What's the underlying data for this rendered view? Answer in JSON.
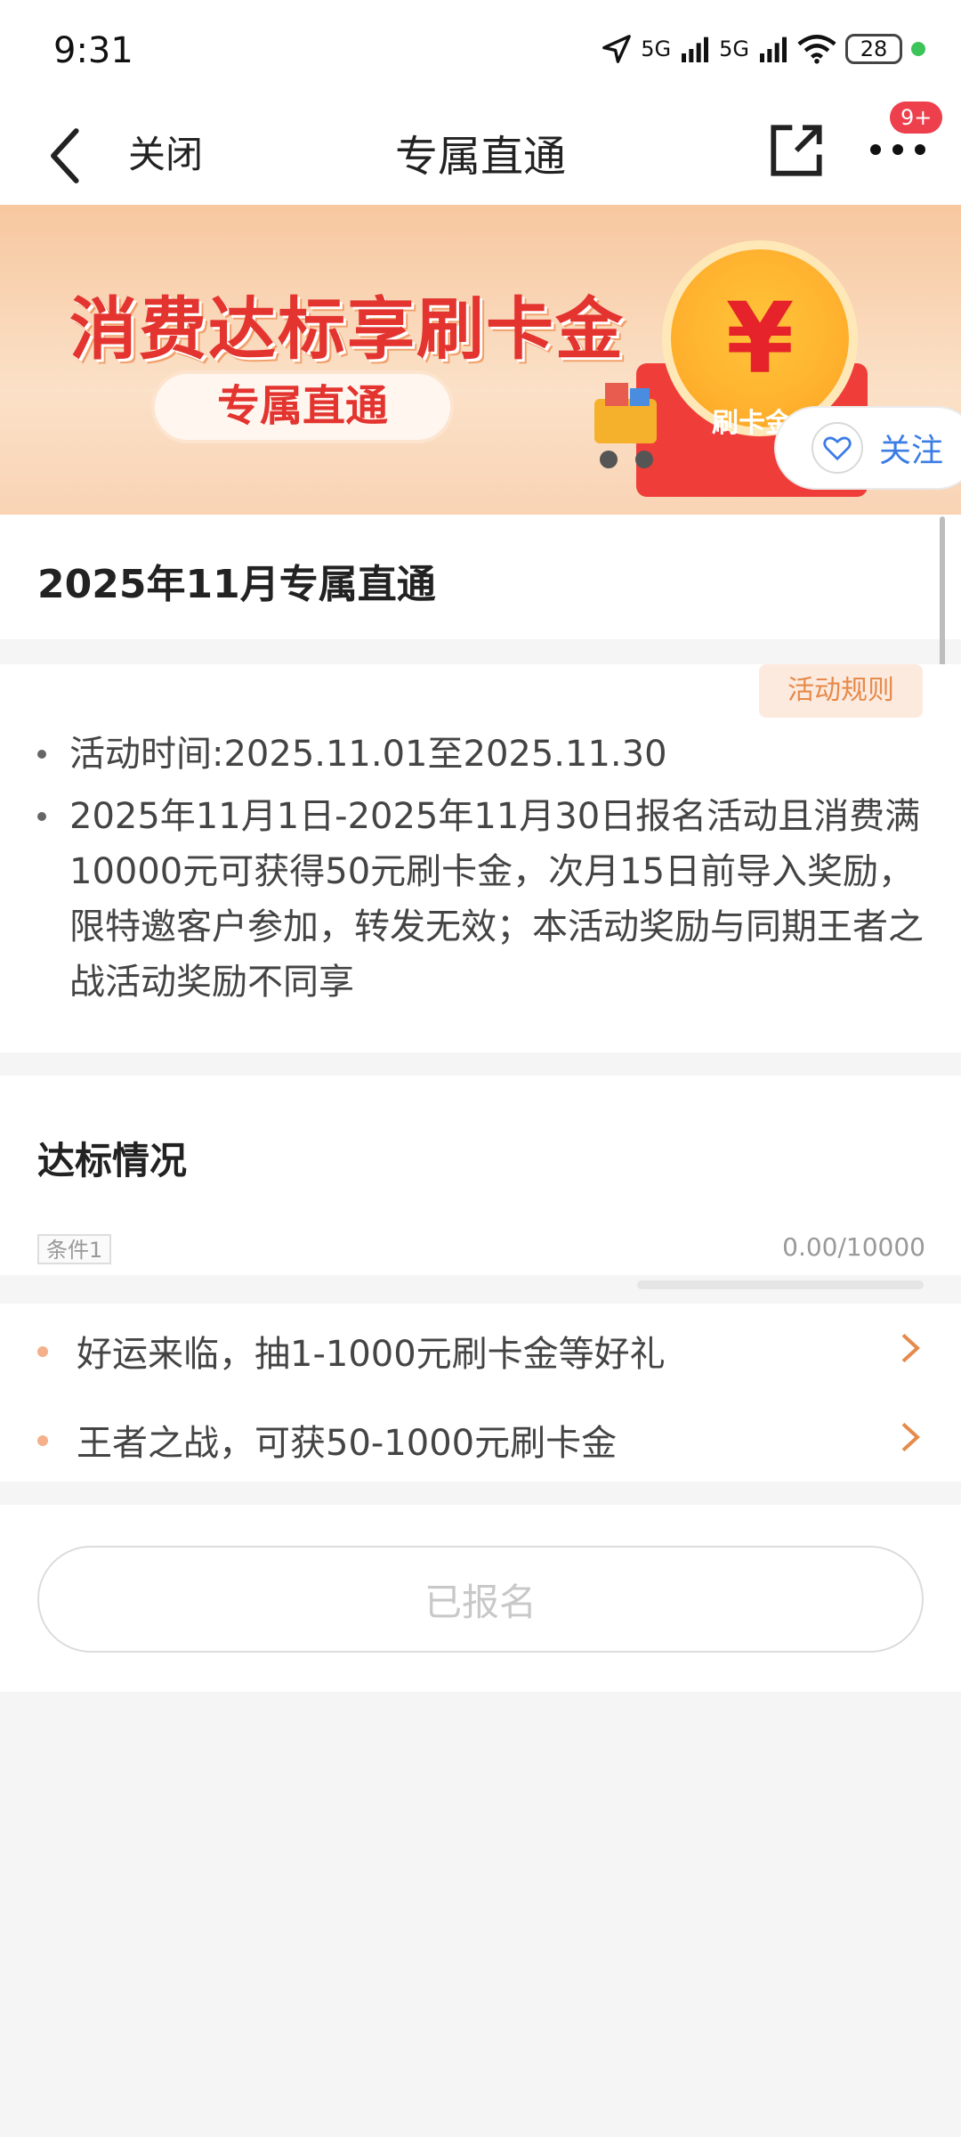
{
  "status_bar": {
    "time": "9:31",
    "battery": "28",
    "signal1": "5G",
    "signal2": "5G"
  },
  "nav": {
    "close_label": "关闭",
    "title": "专属直通",
    "badge": "9+"
  },
  "banner": {
    "headline": "消费达标享刷卡金",
    "pill": "专属直通",
    "card_text": "刷卡金",
    "currency_symbol": "¥"
  },
  "follow": {
    "label": "关注"
  },
  "activity": {
    "title": "2025年11月专属直通",
    "rules_tag": "活动规则",
    "items": [
      "活动时间:2025.11.01至2025.11.30",
      "2025年11月1日-2025年11月30日报名活动且消费满10000元可获得50元刷卡金，次月15日前导入奖励，限特邀客户参加，转发无效；本活动奖励与同期王者之战活动奖励不同享"
    ]
  },
  "achievement": {
    "title": "达标情况",
    "condition_tag": "条件1",
    "progress_text": "0.00/10000",
    "progress_fraction": 0.0
  },
  "links": [
    {
      "label": "好运来临，抽1-1000元刷卡金等好礼"
    },
    {
      "label": "王者之战，可获50-1000元刷卡金"
    }
  ],
  "register": {
    "label": "已报名"
  },
  "colors": {
    "accent_orange": "#f28c38",
    "brand_red": "#e3342f",
    "link_blue": "#3b7ce6"
  }
}
